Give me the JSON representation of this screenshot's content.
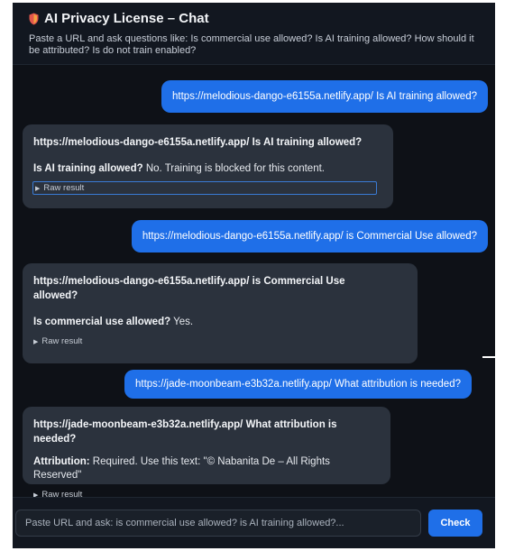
{
  "header": {
    "icon": "shield-icon",
    "title": "AI Privacy License – Chat",
    "subtitle": "Paste a URL and ask questions like: Is commercial use allowed? Is AI training allowed? How should it be attributed? Is do not train enabled?"
  },
  "messages": [
    {
      "role": "user",
      "text": "https://melodious-dango-e6155a.netlify.app/ Is AI training allowed?"
    },
    {
      "role": "bot",
      "question": "https://melodious-dango-e6155a.netlify.app/ Is AI training allowed?",
      "answer_label": "Is AI training allowed?",
      "answer_text": " No. Training is blocked for this content.",
      "raw_label": "Raw result"
    },
    {
      "role": "user",
      "text": "https://melodious-dango-e6155a.netlify.app/ is Commercial Use allowed?"
    },
    {
      "role": "bot",
      "question": "https://melodious-dango-e6155a.netlify.app/ is Commercial Use allowed?",
      "answer_label": "Is commercial use allowed?",
      "answer_text": " Yes.",
      "raw_label": "Raw result"
    },
    {
      "role": "user",
      "text": "https://jade-moonbeam-e3b32a.netlify.app/ What attribution is needed?"
    },
    {
      "role": "bot",
      "question": "https://jade-moonbeam-e3b32a.netlify.app/ What attribution is needed?",
      "answer_label": "Attribution:",
      "answer_text": " Required. Use this text: \"© Nabanita De – All Rights Reserved\"",
      "raw_label": "Raw result"
    }
  ],
  "composer": {
    "placeholder": "Paste URL and ask: is commercial use allowed? is AI training allowed?...",
    "value": "",
    "button_label": "Check"
  },
  "colors": {
    "background": "#0e1117",
    "user_bubble": "#1f6fe8",
    "bot_card": "#2b323d",
    "accent": "#1f6fe8"
  }
}
